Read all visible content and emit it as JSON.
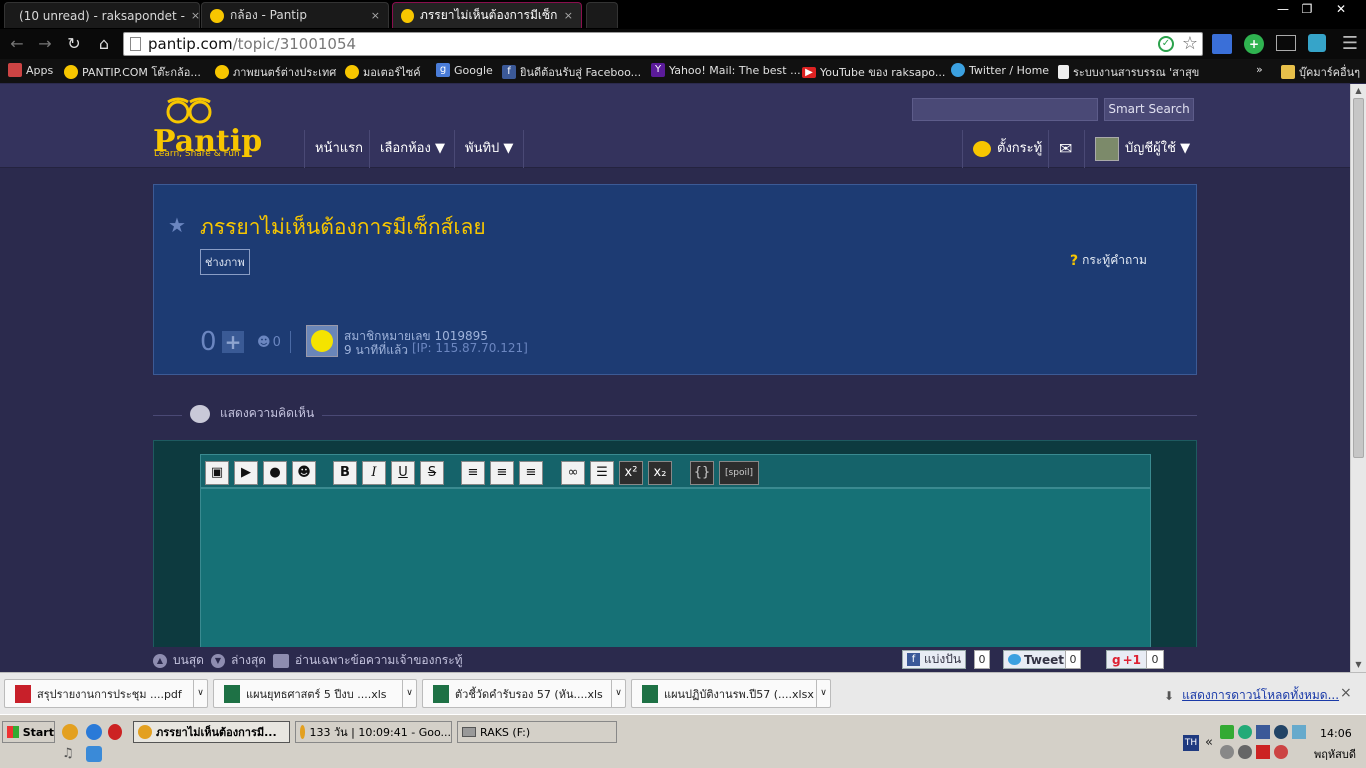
{
  "browser": {
    "tabs": [
      {
        "label": "(10 unread) - raksapondet -",
        "icon": "mail-icon"
      },
      {
        "label": "กล้อง - Pantip",
        "icon": "pantip-icon"
      },
      {
        "label": "ภรรยาไม่เห็นต้องการมีเซ็กส์เ",
        "icon": "pantip-icon",
        "active": true
      }
    ],
    "close_glyph": "×",
    "url_domain": "pantip.com",
    "url_path": "/topic/31001054",
    "bookmarks": [
      {
        "label": "Apps",
        "icon": "apps-icon"
      },
      {
        "label": "PANTIP.COM โต๊ะกล้อ...",
        "icon": "pantip-icon"
      },
      {
        "label": "ภาพยนตร์ต่างประเทศ",
        "icon": "pantip-icon"
      },
      {
        "label": "มอเตอร์ไซค์",
        "icon": "pantip-icon"
      },
      {
        "label": "Google",
        "icon": "google-icon"
      },
      {
        "label": "ยินดีต้อนรับสู่ Faceboo...",
        "icon": "facebook-icon"
      },
      {
        "label": "Yahoo! Mail: The best ...",
        "icon": "yahoo-icon"
      },
      {
        "label": "YouTube ของ raksapo...",
        "icon": "youtube-icon"
      },
      {
        "label": "Twitter / Home",
        "icon": "twitter-icon"
      },
      {
        "label": "ระบบงานสารบรรณ 'สาสุข",
        "icon": "page-icon"
      }
    ],
    "bookmarks_more": "»",
    "other_bookmarks": "บุ๊คมาร์คอื่นๆ"
  },
  "site": {
    "logo": "Pantip",
    "logo_tagline": "Learn, Share & Fun",
    "search_button": "Smart Search",
    "search_placeholder": "",
    "nav": [
      {
        "label": "หน้าแรก"
      },
      {
        "label": "เลือกห้อง ▼"
      },
      {
        "label": "พันทิป ▼"
      }
    ],
    "new_topic": "ตั้งกระทู้",
    "account": "บัญชีผู้ใช้ ▼"
  },
  "topic": {
    "title": "ภรรยาไม่เห็นต้องการมีเซ็กส์เลย",
    "tag": "ช่างภาพ",
    "type": "กระทู้คำถาม",
    "score": "0",
    "emote_count": "0",
    "author": "สมาชิกหมายเลข 1019895",
    "posted": "9 นาทีที่แล้ว",
    "ip": "[IP: 115.87.70.121]"
  },
  "comment": {
    "section_label": "แสดงความคิดเห็น",
    "toolbar": {
      "bold": "B",
      "italic": "I",
      "underline": "U",
      "strike": "S",
      "sup": "x²",
      "sub": "x₂",
      "code": "{}",
      "spoil": "[spoil]"
    }
  },
  "footer": {
    "top": "บนสุด",
    "bottom": "ล่างสุด",
    "owner_only": "อ่านเฉพาะข้อความเจ้าของกระทู้",
    "share_fb": "แบ่งปัน",
    "share_fb_count": "0",
    "tweet": "Tweet",
    "tweet_count": "0",
    "gplus": "+1",
    "gplus_count": "0"
  },
  "downloads": {
    "items": [
      {
        "label": "สรุปรายงานการประชุม ....pdf",
        "icon": "pdf-icon"
      },
      {
        "label": "แผนยุทธศาสตร์ 5 ปีงบ ....xls",
        "icon": "excel-icon"
      },
      {
        "label": "ตัวชี้วัดคำรับรอง 57 (หัน....xls",
        "icon": "excel-icon"
      },
      {
        "label": "แผนปฏิบัติงานรพ.ปี57 (....xlsx",
        "icon": "excel-icon"
      }
    ],
    "show_all": "แสดงการดาวน์โหลดทั้งหมด...",
    "close": "×"
  },
  "taskbar": {
    "start": "Start",
    "windows": [
      {
        "label": "ภรรยาไม่เห็นต้องการมี...",
        "active": true
      },
      {
        "label": "133 วัน | 10:09:41 - Goo..."
      },
      {
        "label": "RAKS (F:)"
      }
    ],
    "lang": "TH",
    "tray_toggle": "«",
    "time": "14:06",
    "day": "พฤหัสบดี"
  },
  "colors": {
    "accent": "#f7c600",
    "page_bg": "#2b2a4d",
    "topic_bg": "#1d3b73",
    "editor_bg": "#167176"
  }
}
